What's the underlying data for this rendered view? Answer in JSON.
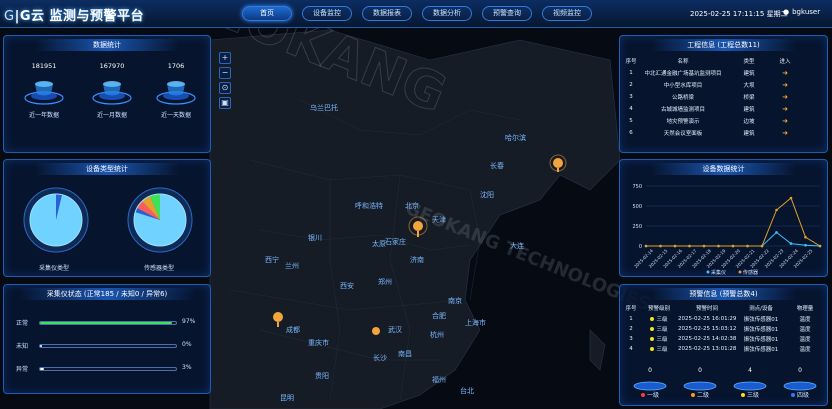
{
  "header": {
    "logo_prefix": "G",
    "logo_brand": "|G云",
    "logo_title": "监测与预警平台",
    "datetime": "2025-02-25 17:11:15 星期二",
    "user": "bgkuser",
    "tabs": [
      {
        "label": "首页",
        "active": true
      },
      {
        "label": "设备监控"
      },
      {
        "label": "数据报表"
      },
      {
        "label": "数据分析"
      },
      {
        "label": "预警查询"
      },
      {
        "label": "视频监控"
      }
    ]
  },
  "map": {
    "cities": [
      {
        "name": "乌兰巴托"
      },
      {
        "name": "哈尔滨"
      },
      {
        "name": "长春"
      },
      {
        "name": "沈阳"
      },
      {
        "name": "呼和浩特"
      },
      {
        "name": "北京"
      },
      {
        "name": "天津"
      },
      {
        "name": "大连"
      },
      {
        "name": "银川"
      },
      {
        "name": "太原"
      },
      {
        "name": "石家庄"
      },
      {
        "name": "济南"
      },
      {
        "name": "西宁"
      },
      {
        "name": "兰州"
      },
      {
        "name": "西安"
      },
      {
        "name": "郑州"
      },
      {
        "name": "合肥"
      },
      {
        "name": "南京"
      },
      {
        "name": "上海市"
      },
      {
        "name": "成都"
      },
      {
        "name": "重庆市"
      },
      {
        "name": "武汉"
      },
      {
        "name": "杭州"
      },
      {
        "name": "长沙"
      },
      {
        "name": "南昌"
      },
      {
        "name": "贵阳"
      },
      {
        "name": "福州"
      },
      {
        "name": "昆明"
      },
      {
        "name": "台北"
      }
    ],
    "watermark": "GEOKANG",
    "watermark2": "GEOKANG TECHNOLOGIES"
  },
  "stats": {
    "title": "数据统计",
    "items": [
      {
        "value": "181951",
        "label": "近一年数据"
      },
      {
        "value": "167970",
        "label": "近一月数据"
      },
      {
        "value": "1706",
        "label": "近一天数据"
      }
    ]
  },
  "devtype": {
    "title": "设备类型统计",
    "left_label": "采集仪类型",
    "right_label": "传感器类型"
  },
  "collector": {
    "title": "采集仪状态 (正常185 / 未知0 / 异常6)",
    "rows": [
      {
        "label": "正常",
        "pct": "97%",
        "value": 97,
        "color": "#3ce35a"
      },
      {
        "label": "未知",
        "pct": "0%",
        "value": 0,
        "color": "#ffffff"
      },
      {
        "label": "异常",
        "pct": "3%",
        "value": 3,
        "color": "#ffffff"
      }
    ]
  },
  "projects": {
    "title": "工程信息 (工程总数11)",
    "headers": [
      "序号",
      "名称",
      "类型",
      "进入"
    ],
    "rows": [
      [
        "1",
        "中北汇通金融广场基坑监测项目",
        "建筑"
      ],
      [
        "2",
        "中小型水库项目",
        "大坝"
      ],
      [
        "3",
        "公路桥梁",
        "桥梁"
      ],
      [
        "4",
        "古城城墙监测项目",
        "建筑"
      ],
      [
        "5",
        "地灾预警演示",
        "边坡"
      ],
      [
        "6",
        "天然会议室面板",
        "建筑"
      ]
    ]
  },
  "trend": {
    "title": "设备数据统计",
    "legend": [
      "采集仪",
      "传感器"
    ]
  },
  "alerts": {
    "title": "预警信息 (预警总数4)",
    "headers": [
      "序号",
      "预警级别",
      "预警时间",
      "测点/设备",
      "物理量"
    ],
    "rows": [
      [
        "1",
        "三级",
        "2025-02-25 16:01:29",
        "振弦传感器01",
        "温度"
      ],
      [
        "2",
        "三级",
        "2025-02-25 15:03:12",
        "振弦传感器01",
        "温度"
      ],
      [
        "3",
        "三级",
        "2025-02-25 14:02:38",
        "振弦传感器01",
        "温度"
      ],
      [
        "4",
        "三级",
        "2025-02-25 13:01:28",
        "振弦传感器01",
        "温度"
      ]
    ],
    "levels": [
      {
        "count": "0",
        "label": "一级",
        "color": "#ff3b3b"
      },
      {
        "count": "0",
        "label": "二级",
        "color": "#ff9a1f"
      },
      {
        "count": "4",
        "label": "三级",
        "color": "#f5e21a"
      },
      {
        "count": "0",
        "label": "四级",
        "color": "#2f7bff"
      }
    ]
  },
  "chart_data": {
    "type": "line",
    "x": [
      "2025-02-14",
      "2025-02-15",
      "2025-02-16",
      "2025-02-17",
      "2025-02-18",
      "2025-02-19",
      "2025-02-20",
      "2025-02-21",
      "2025-02-22",
      "2025-02-23",
      "2025-02-24",
      "2025-02-25"
    ],
    "series": [
      {
        "name": "采集仪",
        "color": "#38c6ff",
        "values": [
          0,
          0,
          0,
          0,
          0,
          0,
          0,
          0,
          0,
          170,
          30,
          10,
          0
        ]
      },
      {
        "name": "传感器",
        "color": "#e2a12a",
        "values": [
          0,
          0,
          0,
          0,
          0,
          0,
          0,
          0,
          0,
          450,
          600,
          110,
          0
        ]
      }
    ],
    "yticks": [
      "0",
      "250",
      "500",
      "750"
    ],
    "ylim": [
      0,
      750
    ]
  },
  "colors": {
    "accent": "#1d5db5",
    "map_land": "#141a22"
  }
}
